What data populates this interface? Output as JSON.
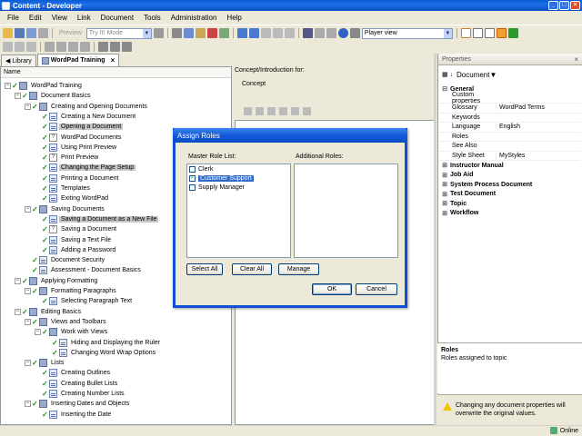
{
  "window": {
    "title": "Content - Developer"
  },
  "menu": [
    "File",
    "Edit",
    "View",
    "Link",
    "Document",
    "Tools",
    "Administration",
    "Help"
  ],
  "toolbar": {
    "preview_label": "Preview",
    "mode_select": "Try It! Mode",
    "view_select": "Player view"
  },
  "tabs": [
    {
      "label": "Library"
    },
    {
      "label": "WordPad Training"
    }
  ],
  "left": {
    "column_header": "Name",
    "tree": [
      {
        "label": "WordPad Training",
        "level": 0,
        "icon": "book"
      },
      {
        "label": "Document Basics",
        "level": 1,
        "icon": "book"
      },
      {
        "label": "Creating and Opening Documents",
        "level": 2,
        "icon": "book"
      },
      {
        "label": "Creating a New Document",
        "level": 3,
        "icon": "topic"
      },
      {
        "label": "Opening a Document",
        "level": 3,
        "icon": "topic",
        "selected": true
      },
      {
        "label": "WordPad Documents",
        "level": 3,
        "icon": "q"
      },
      {
        "label": "Using Print Preview",
        "level": 3,
        "icon": "topic"
      },
      {
        "label": "Print Preview",
        "level": 3,
        "icon": "q"
      },
      {
        "label": "Changing the Page Setup",
        "level": 3,
        "icon": "topic",
        "selected": true
      },
      {
        "label": "Printing a Document",
        "level": 3,
        "icon": "topic"
      },
      {
        "label": "Templates",
        "level": 3,
        "icon": "topic"
      },
      {
        "label": "Exiting WordPad",
        "level": 3,
        "icon": "topic"
      },
      {
        "label": "Saving Documents",
        "level": 2,
        "icon": "book"
      },
      {
        "label": "Saving a Document as a New File",
        "level": 3,
        "icon": "topic",
        "selected": true
      },
      {
        "label": "Saving a Document",
        "level": 3,
        "icon": "q"
      },
      {
        "label": "Saving a Text File",
        "level": 3,
        "icon": "topic"
      },
      {
        "label": "Adding a Password",
        "level": 3,
        "icon": "topic"
      },
      {
        "label": "Document Security",
        "level": 2,
        "icon": "topic"
      },
      {
        "label": "Assessment - Document Basics",
        "level": 2,
        "icon": "topic"
      },
      {
        "label": "Applying Formatting",
        "level": 1,
        "icon": "book"
      },
      {
        "label": "Formatting Paragraphs",
        "level": 2,
        "icon": "book"
      },
      {
        "label": "Selecting Paragraph Text",
        "level": 3,
        "icon": "topic"
      },
      {
        "label": "Editing Basics",
        "level": 1,
        "icon": "book"
      },
      {
        "label": "Views and Toolbars",
        "level": 2,
        "icon": "book"
      },
      {
        "label": "Work with Views",
        "level": 3,
        "icon": "book"
      },
      {
        "label": "Hiding and Displaying the Ruler",
        "level": 4,
        "icon": "topic"
      },
      {
        "label": "Changing Word Wrap Options",
        "level": 4,
        "icon": "topic"
      },
      {
        "label": "Lists",
        "level": 2,
        "icon": "book"
      },
      {
        "label": "Creating Outlines",
        "level": 3,
        "icon": "topic"
      },
      {
        "label": "Creating Bullet Lists",
        "level": 3,
        "icon": "topic"
      },
      {
        "label": "Creating Number Lists",
        "level": 3,
        "icon": "topic"
      },
      {
        "label": "Inserting Dates and Objects",
        "level": 2,
        "icon": "book"
      },
      {
        "label": "Inserting the Date",
        "level": 3,
        "icon": "topic"
      }
    ]
  },
  "middle": {
    "header": "Concept/Introduction for:",
    "subheader": "Concept"
  },
  "properties": {
    "title": "Properties",
    "selector": "Document",
    "general_label": "General",
    "general_rows": [
      {
        "name": "Custom properties",
        "value": ""
      },
      {
        "name": "Glossary",
        "value": "WordPad Terms"
      },
      {
        "name": "Keywords",
        "value": ""
      },
      {
        "name": "Language",
        "value": "English"
      },
      {
        "name": "Roles",
        "value": ""
      },
      {
        "name": "See Also",
        "value": ""
      },
      {
        "name": "Style Sheet",
        "value": "MyStyles"
      }
    ],
    "categories": [
      "Instructor Manual",
      "Job Aid",
      "System Process Document",
      "Test Document",
      "Topic",
      "Workflow"
    ],
    "desc_title": "Roles",
    "desc_text": "Roles assigned to topic",
    "warning": "Changing any document properties will overwrite the original values."
  },
  "status": {
    "online": "Online"
  },
  "dialog": {
    "title": "Assign Roles",
    "master_label": "Master Role List:",
    "additional_label": "Additional Roles:",
    "roles": [
      {
        "label": "Clerk",
        "checked": false
      },
      {
        "label": "Customer Support",
        "checked": true
      },
      {
        "label": "Supply Manager",
        "checked": false
      }
    ],
    "select_all": "Select All",
    "clear_all": "Clear All",
    "manage": "Manage",
    "ok": "OK",
    "cancel": "Cancel"
  }
}
